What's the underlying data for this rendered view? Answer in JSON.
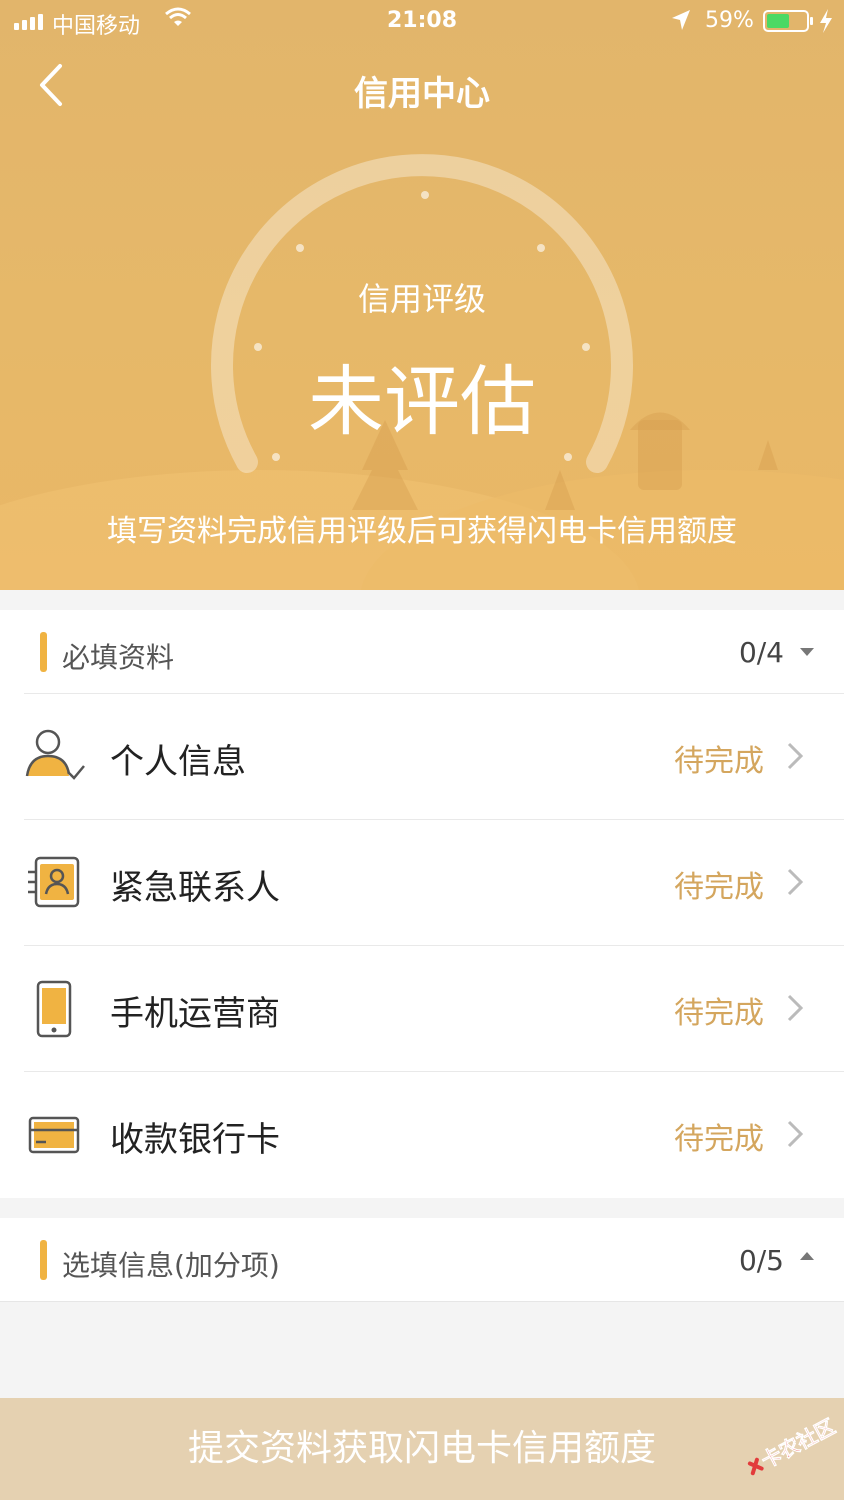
{
  "status_bar": {
    "carrier": "中国移动",
    "time": "21:08",
    "battery_percent": "59%",
    "battery_level": 0.59
  },
  "nav": {
    "title": "信用中心"
  },
  "hero": {
    "rating_label": "信用评级",
    "rating_value": "未评估",
    "hint": "填写资料完成信用评级后可获得闪电卡信用额度"
  },
  "required_section": {
    "label": "必填资料",
    "count": "0/4",
    "items": [
      {
        "label": "个人信息",
        "status": "待完成",
        "icon": "person-check-icon"
      },
      {
        "label": "紧急联系人",
        "status": "待完成",
        "icon": "contact-card-icon"
      },
      {
        "label": "手机运营商",
        "status": "待完成",
        "icon": "mobile-phone-icon"
      },
      {
        "label": "收款银行卡",
        "status": "待完成",
        "icon": "bank-card-icon"
      }
    ]
  },
  "optional_section": {
    "label": "选填信息(加分项)",
    "count": "0/5"
  },
  "footer": {
    "button_label": "提交资料获取闪电卡信用额度"
  },
  "watermark": {
    "text": "卡农社区"
  },
  "colors": {
    "hero": "#e6b869",
    "accent": "#f0b342",
    "status_text": "#d4a65e",
    "footer_button": "#e5d1b1"
  }
}
